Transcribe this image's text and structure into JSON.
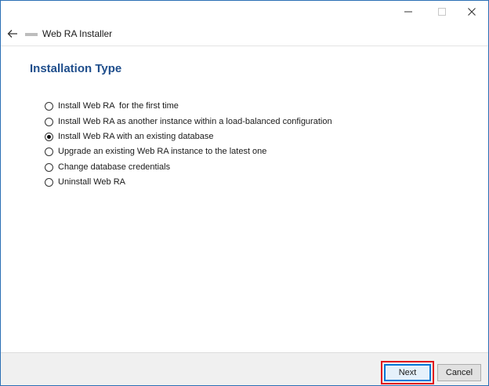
{
  "window": {
    "title": "Web RA  Installer",
    "logo_text": "Web RA"
  },
  "page": {
    "title": "Installation Type"
  },
  "options": [
    {
      "label": "Install Web RA  for the first time",
      "checked": false
    },
    {
      "label": "Install Web RA as another instance within a load-balanced configuration",
      "checked": false
    },
    {
      "label": "Install Web RA with an existing database",
      "checked": true
    },
    {
      "label": "Upgrade an existing Web RA instance to the latest one",
      "checked": false
    },
    {
      "label": "Change database credentials",
      "checked": false
    },
    {
      "label": "Uninstall Web RA",
      "checked": false
    }
  ],
  "footer": {
    "next_label": "Next",
    "cancel_label": "Cancel"
  },
  "colors": {
    "accent": "#1f4e8c",
    "window_border": "#2b6fb5",
    "highlight": "#e0101e",
    "focus": "#0078d7"
  },
  "icons": {
    "back": "arrow-left-icon",
    "minimize": "minimize-icon",
    "maximize": "maximize-icon",
    "close": "close-icon"
  }
}
